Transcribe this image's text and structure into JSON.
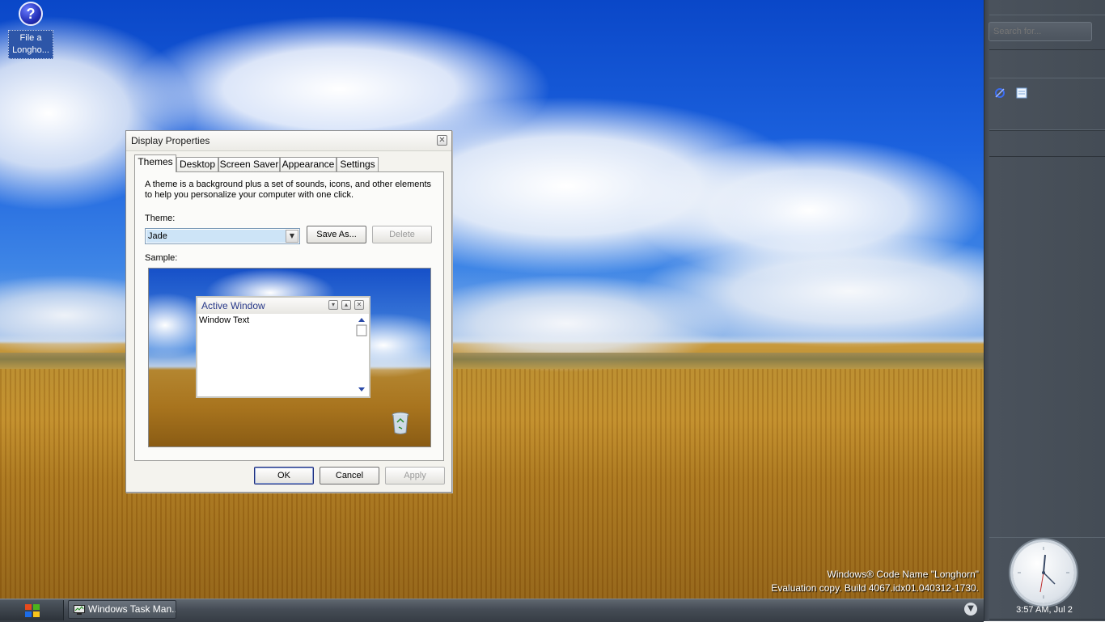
{
  "desktop": {
    "icons": [
      {
        "label": "File a Longho...",
        "icon": "help-icon"
      }
    ],
    "watermark": {
      "line1": "Windows® Code Name \"Longhorn\"",
      "line2": "Evaluation copy. Build 4067.idx01.040312-1730."
    }
  },
  "sidebar": {
    "search_placeholder": "Search for...",
    "tiles": [
      "blue-swirl-icon",
      "notepad-icon"
    ],
    "clock_time": "3:57 AM, Jul 2"
  },
  "taskbar": {
    "start_icon": "windows-flag-icon",
    "tasks": [
      {
        "label": "Windows Task Man...",
        "icon": "task-manager-icon"
      }
    ],
    "tray_icon": "chevron-down-icon"
  },
  "dialog": {
    "title": "Display Properties",
    "tabs": [
      "Themes",
      "Desktop",
      "Screen Saver",
      "Appearance",
      "Settings"
    ],
    "active_tab": "Themes",
    "description_line1": "A theme is a background plus a set of sounds, icons, and other elements",
    "description_line2": "to help you personalize your computer with one click.",
    "theme_label": "Theme:",
    "theme_value": "Jade",
    "save_as_label": "Save As...",
    "delete_label": "Delete",
    "sample_label": "Sample:",
    "sample": {
      "window_title": "Active Window",
      "window_text": "Window Text"
    },
    "ok_label": "OK",
    "cancel_label": "Cancel",
    "apply_label": "Apply"
  },
  "colors": {
    "sidebar_bg": "#444c55",
    "taskbar_bg": "#454c55",
    "dialog_bg": "#f4f3ee",
    "selection": "#cde4f7",
    "title_text": "#2a3a8a"
  }
}
